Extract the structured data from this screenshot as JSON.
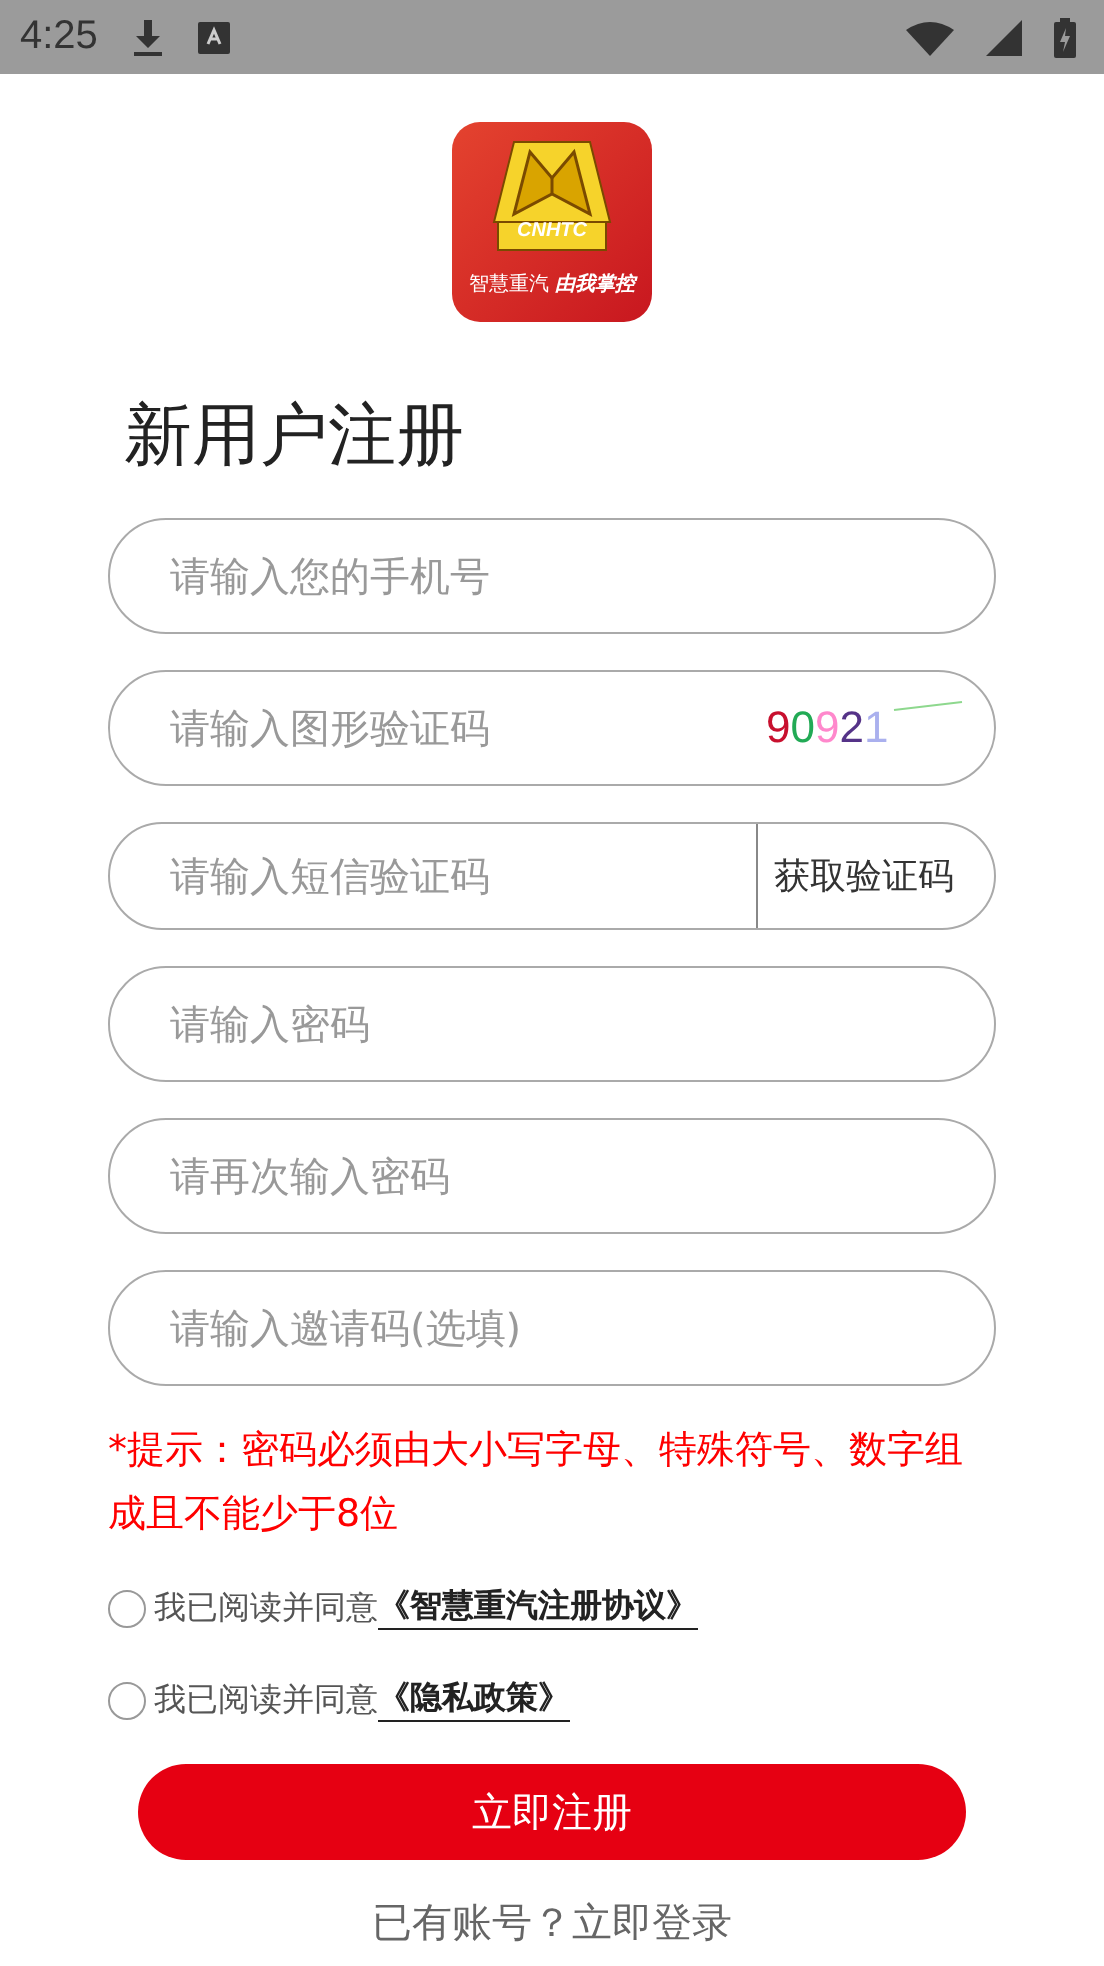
{
  "status_bar": {
    "time": "4:25"
  },
  "logo": {
    "brand": "CNHTC",
    "tagline_left": "智慧重汽",
    "tagline_right": "由我掌控"
  },
  "title": "新用户注册",
  "fields": [
    {
      "kind": "plain",
      "placeholder": "请输入您的手机号"
    },
    {
      "kind": "captcha",
      "placeholder": "请输入图形验证码",
      "captcha": [
        {
          "char": "9",
          "color": "#c8102e"
        },
        {
          "char": "0",
          "color": "#22aa55"
        },
        {
          "char": "9",
          "color": "#ff88cc"
        },
        {
          "char": "2",
          "color": "#553388"
        },
        {
          "char": "1",
          "color": "#aab0ee"
        }
      ]
    },
    {
      "kind": "sms",
      "placeholder": "请输入短信验证码",
      "button": "获取验证码"
    },
    {
      "kind": "plain",
      "placeholder": "请输入密码"
    },
    {
      "kind": "plain",
      "placeholder": "请再次输入密码"
    },
    {
      "kind": "plain",
      "placeholder": "请输入邀请码(选填)"
    }
  ],
  "hint": "*提示：密码必须由大小写字母、特殊符号、数字组成且不能少于8位",
  "agreements": [
    {
      "label": "我已阅读并同意",
      "link": "《智慧重汽注册协议》",
      "checked": false
    },
    {
      "label": "我已阅读并同意",
      "link": "《隐私政策》",
      "checked": false
    }
  ],
  "register_button": "立即注册",
  "login_link": "已有账号？立即登录"
}
